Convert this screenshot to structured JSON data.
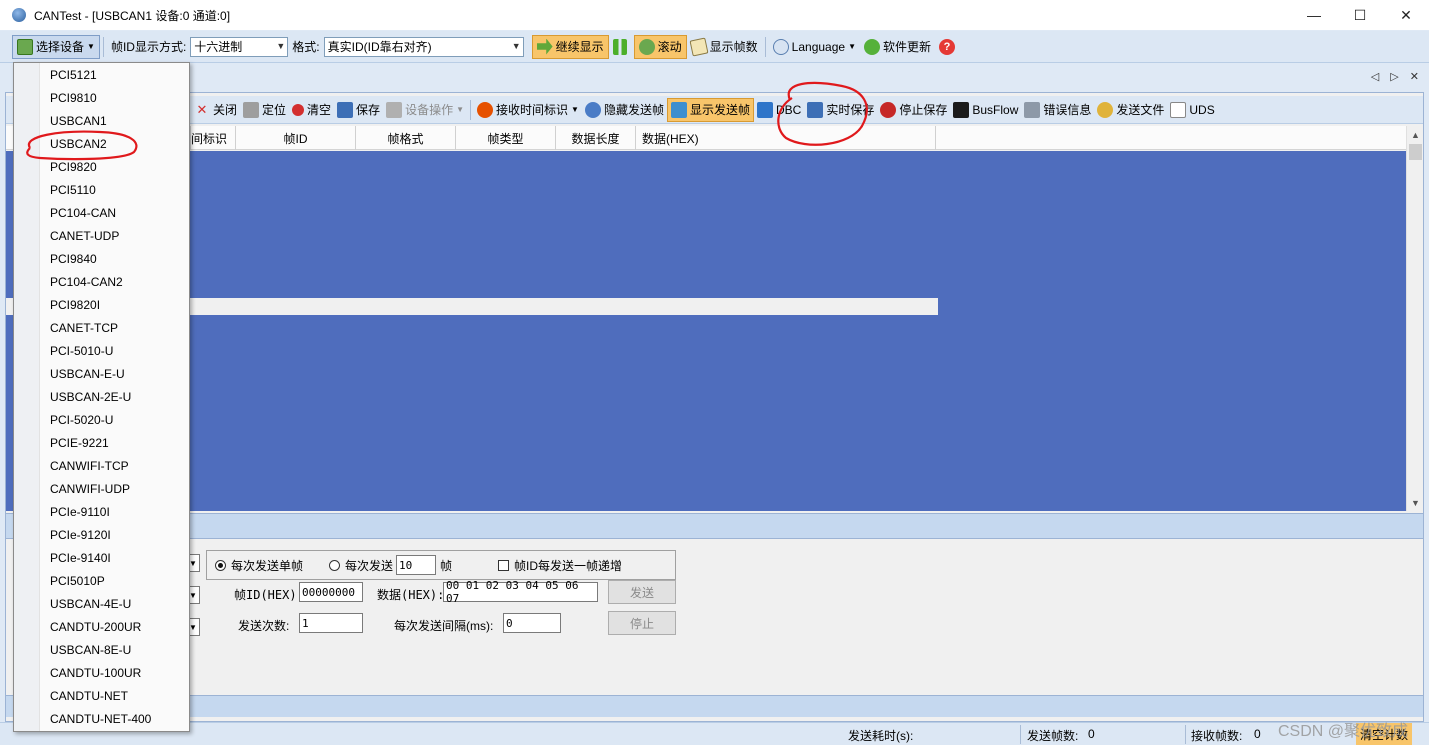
{
  "window": {
    "title": "CANTest  - [USBCAN1 设备:0 通道:0]",
    "minimize": "—",
    "maximize": "☐",
    "close": "✕"
  },
  "toolbar1": {
    "select_device": "选择设备",
    "frame_id_label": "帧ID显示方式:",
    "frame_id_value": "十六进制",
    "format_label": "格式:",
    "format_value": "真实ID(ID靠右对齐)",
    "continue_display": "继续显示",
    "scroll": "滚动",
    "show_frame_count": "显示帧数",
    "language": "Language",
    "software_update": "软件更新"
  },
  "tab_controls": "◁ ▷ ✕",
  "toolbar2": {
    "close": "关闭",
    "locate": "定位",
    "clear": "清空",
    "save": "保存",
    "device_ops": "设备操作",
    "recv_timestamp": "接收时间标识",
    "hide_sent": "隐藏发送帧",
    "show_sent": "显示发送帧",
    "dbc": "DBC",
    "realtime_save": "实时保存",
    "stop_save": "停止保存",
    "busflow": "BusFlow",
    "error_info": "错误信息",
    "send_file": "发送文件",
    "uds": "UDS"
  },
  "grid": {
    "columns": [
      "间标识",
      "帧ID",
      "帧格式",
      "帧类型",
      "数据长度",
      "数据(HEX)"
    ]
  },
  "send_panel": {
    "mode_single": "每次发送单帧",
    "mode_multi": "每次发送",
    "multi_count": "10",
    "frame_unit": "帧",
    "id_increment": "帧ID每发送一帧递增",
    "frame_id_label": "帧ID(HEX):",
    "frame_id_value": "00000000",
    "data_label": "数据(HEX):",
    "data_value": "00 01 02 03 04 05 06 07",
    "send_button": "发送",
    "send_count_label": "发送次数:",
    "send_count_value": "1",
    "interval_label": "每次发送间隔(ms):",
    "interval_value": "0",
    "stop_button": "停止"
  },
  "statusbar": {
    "send_time_label": "发送耗时(s):",
    "sent_frames_label": "发送帧数:",
    "sent_frames_value": "0",
    "recv_frames_label": "接收帧数:",
    "recv_frames_value": "0",
    "clear_count": "清空计数"
  },
  "watermark": "CSDN @聚优致成",
  "device_menu": {
    "items": [
      "PCI5121",
      "PCI9810",
      "USBCAN1",
      "USBCAN2",
      "PCI9820",
      "PCI5110",
      "PC104-CAN",
      "CANET-UDP",
      "PCI9840",
      "PC104-CAN2",
      "PCI9820I",
      "CANET-TCP",
      "PCI-5010-U",
      "USBCAN-E-U",
      "USBCAN-2E-U",
      "PCI-5020-U",
      "PCIE-9221",
      "CANWIFI-TCP",
      "CANWIFI-UDP",
      "PCIe-9110I",
      "PCIe-9120I",
      "PCIe-9140I",
      "PCI5010P",
      "USBCAN-4E-U",
      "CANDTU-200UR",
      "USBCAN-8E-U",
      "CANDTU-100UR",
      "CANDTU-NET",
      "CANDTU-NET-400"
    ],
    "circled_item": "USBCAN2"
  },
  "colors": {
    "grid_background": "#4f6dbd",
    "highlight": "#f8c56a",
    "annotation": "#e0191c"
  }
}
